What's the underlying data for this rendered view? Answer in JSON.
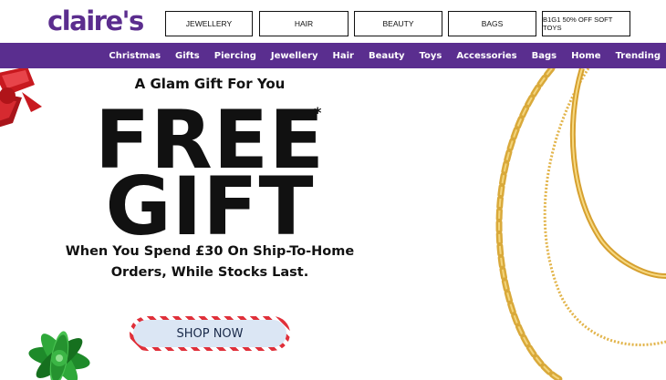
{
  "header": {
    "logo_text": "claire's",
    "pills": [
      {
        "label": "JEWELLERY"
      },
      {
        "label": "HAIR"
      },
      {
        "label": "BEAUTY"
      },
      {
        "label": "BAGS"
      },
      {
        "label": "B1G1 50% OFF SOFT TOYS"
      }
    ]
  },
  "nav": {
    "items": [
      {
        "label": "Christmas"
      },
      {
        "label": "Gifts"
      },
      {
        "label": "Piercing"
      },
      {
        "label": "Jewellery"
      },
      {
        "label": "Hair"
      },
      {
        "label": "Beauty"
      },
      {
        "label": "Toys"
      },
      {
        "label": "Accessories"
      },
      {
        "label": "Bags"
      },
      {
        "label": "Home"
      },
      {
        "label": "Trending"
      }
    ]
  },
  "hero": {
    "subhead": "A Glam Gift For You",
    "title_line1": "FREE",
    "title_line2": "GIFT",
    "asterisk": "*",
    "body_line1": "When You Spend £30 On Ship-To-Home",
    "body_line2": "Orders, While Stocks Last.",
    "cta_label": "SHOP NOW"
  },
  "colors": {
    "brand_purple": "#5a2e8f",
    "gold": "#d9a93a",
    "bow_red": "#c8191f",
    "bow_green": "#1e8a2a",
    "cta_stripe_red": "#e0303a",
    "cta_fill": "#dbe6f4"
  },
  "icons": [
    "red-gift-bow-icon",
    "green-gift-bow-icon",
    "gold-chain-necklace-image"
  ]
}
